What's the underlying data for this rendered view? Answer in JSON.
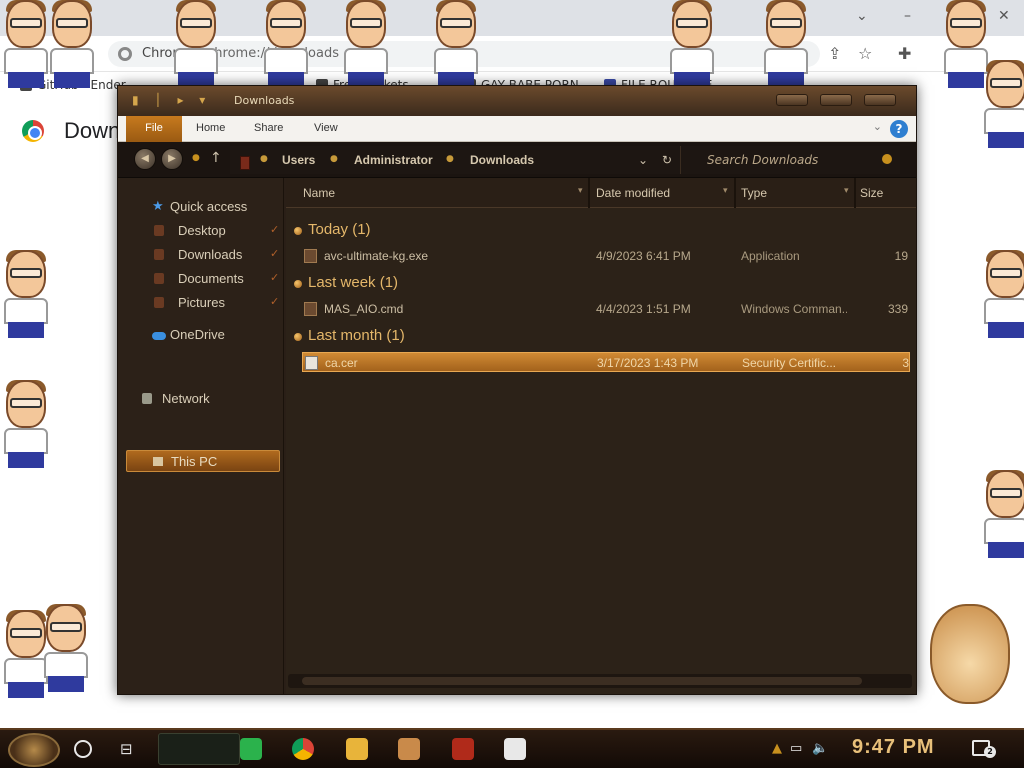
{
  "browser": {
    "tab_title": "Chrome",
    "omnibox_text": "chrome://downloads",
    "bookmarks": [
      "GitHub - Ender",
      "Free Trinkets",
      "GAY BABE PORN",
      "FILE ROULETTE"
    ],
    "page_heading": "Downloads"
  },
  "window": {
    "title": "Downloads",
    "ribbon_tabs": [
      "File",
      "Home",
      "Share",
      "View"
    ],
    "help_label": "?",
    "breadcrumbs": [
      "Users",
      "Administrator",
      "Downloads"
    ],
    "search_placeholder": "Search Downloads"
  },
  "navigation": {
    "quick_access": "Quick access",
    "pinned": [
      "Desktop",
      "Downloads",
      "Documents",
      "Pictures"
    ],
    "onedrive": "OneDrive",
    "this_pc": "This PC",
    "network": "Network"
  },
  "columns": [
    "Name",
    "Date modified",
    "Type",
    "Size"
  ],
  "groups": [
    {
      "label": "Today (1)",
      "files": [
        {
          "name": "avc-ultimate-kg.exe",
          "date": "4/9/2023 6:41 PM",
          "type": "Application",
          "size": "19"
        }
      ]
    },
    {
      "label": "Last week (1)",
      "files": [
        {
          "name": "MAS_AIO.cmd",
          "date": "4/4/2023 1:51 PM",
          "type": "Windows Comman...",
          "size": "339"
        }
      ]
    },
    {
      "label": "Last month (1)",
      "files": [
        {
          "name": "ca.cer",
          "date": "3/17/2023 1:43 PM",
          "type": "Security Certific...",
          "size": "3",
          "selected": true
        }
      ]
    }
  ],
  "taskbar": {
    "clock": "9:47 PM",
    "notification_count": "2"
  },
  "colors": {
    "accent": "#c77a1e",
    "selection": "#d08a34",
    "group_heading": "#e4b76a",
    "clock": "#e8c07a"
  }
}
